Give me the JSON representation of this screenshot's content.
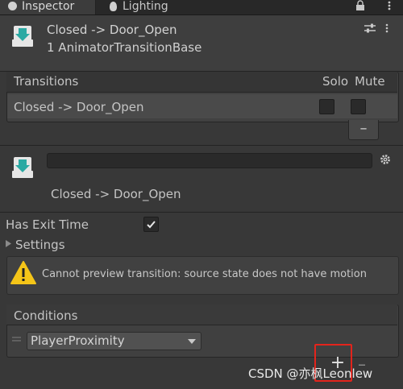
{
  "tabs": [
    {
      "label": "Inspector",
      "icon": "info-icon"
    },
    {
      "label": "Lighting",
      "icon": "light-bulb-icon"
    }
  ],
  "header": {
    "title": "Closed -> Door_Open",
    "subtitle": "1 AnimatorTransitionBase"
  },
  "transitions": {
    "title": "Transitions",
    "solo_label": "Solo",
    "mute_label": "Mute",
    "rows": [
      {
        "name": "Closed -> Door_Open",
        "solo": false,
        "mute": false
      }
    ],
    "remove_label": "–"
  },
  "transition": {
    "name_value": "",
    "label": "Closed -> Door_Open",
    "has_exit_time_label": "Has Exit Time",
    "has_exit_time": true,
    "settings_label": "Settings",
    "warning": "Cannot preview transition: source state does not have motion"
  },
  "conditions": {
    "title": "Conditions",
    "items": [
      {
        "parameter": "PlayerProximity"
      }
    ],
    "add_label": "+",
    "remove_label": "–"
  },
  "watermark": "CSDN @亦枫Leonlew",
  "colors": {
    "highlight": "#e3241c",
    "warning": "#f5c518"
  }
}
